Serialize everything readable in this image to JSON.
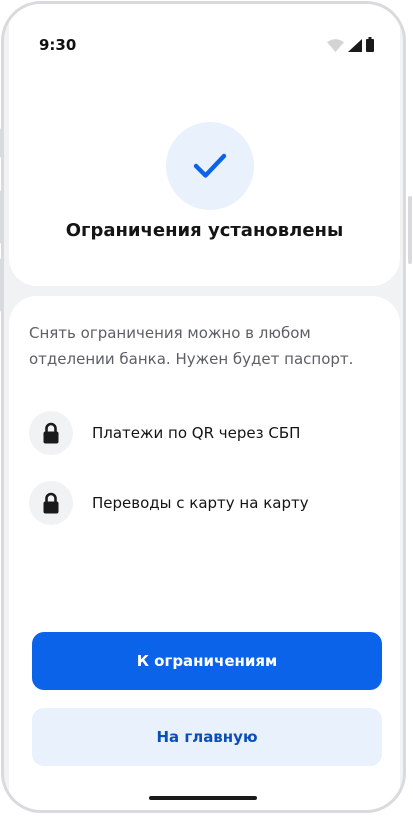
{
  "status_bar": {
    "time": "9:30"
  },
  "header": {
    "title": "Ограничения установлены"
  },
  "content": {
    "description": "Снять ограничения можно в любом отделении банка. Нужен будет паспорт.",
    "limits": [
      {
        "label": "Платежи по QR через СБП",
        "icon": "lock-icon"
      },
      {
        "label": "Переводы с карту на карту",
        "icon": "lock-icon"
      }
    ]
  },
  "actions": {
    "primary_label": "К ограничениям",
    "secondary_label": "На главную"
  },
  "colors": {
    "accent": "#0a63e8",
    "accent_light": "#e9f1fc",
    "background": "#f1f2f4"
  }
}
